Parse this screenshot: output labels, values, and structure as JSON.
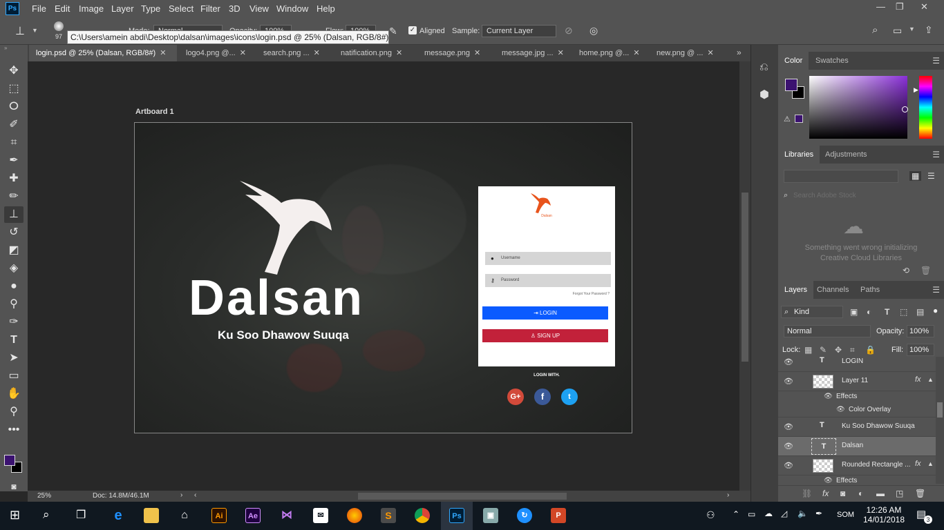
{
  "menubar": {
    "logo": "Ps",
    "items": [
      "File",
      "Edit",
      "Image",
      "Layer",
      "Type",
      "Select",
      "Filter",
      "3D",
      "View",
      "Window",
      "Help"
    ]
  },
  "options": {
    "brush_size": "97",
    "mode_label": "Mode:",
    "mode_value": "Normal",
    "opacity_label": "Opacity:",
    "opacity_value": "100%",
    "flow_label": "Flow:",
    "flow_value": "100%",
    "aligned_label": "Aligned",
    "sample_label": "Sample:",
    "sample_value": "Current Layer"
  },
  "tooltip": "C:\\Users\\amein abdi\\Desktop\\dalsan\\images\\icons\\login.psd @ 25% (Dalsan, RGB/8#)",
  "tabs": [
    {
      "label": "login.psd @ 25% (Dalsan, RGB/8#)"
    },
    {
      "label": "logo4.png @..."
    },
    {
      "label": "search.png ..."
    },
    {
      "label": "natification.png"
    },
    {
      "label": "message.png"
    },
    {
      "label": "message.jpg ..."
    },
    {
      "label": "home.png @..."
    },
    {
      "label": "new.png @ ..."
    }
  ],
  "artboard": {
    "label": "Artboard 1",
    "brand": "Dalsan",
    "tagline": "Ku Soo Dhawow Suuqa",
    "card": {
      "logo_text": "Dalsan",
      "username_placeholder": "Username",
      "password_placeholder": "Password",
      "forgot": "Forgot Your Password ?",
      "login_label": "LOGIN",
      "signup_label": "SIGN UP"
    },
    "login_with": "LOGIN WITH.",
    "social": {
      "google": "G+",
      "facebook": "f",
      "twitter": "t"
    },
    "colors": {
      "login": "#0b5bff",
      "signup": "#c2213a",
      "brand_orange": "#e8541c"
    }
  },
  "status": {
    "zoom": "25%",
    "doc": "Doc: 14.8M/46.1M"
  },
  "color_panel": {
    "tabs": [
      "Color",
      "Swatches"
    ],
    "foreground": "#3b1270",
    "background": "#000000"
  },
  "libraries_panel": {
    "tabs": [
      "Libraries",
      "Adjustments"
    ],
    "search_placeholder": "Search Adobe Stock",
    "error_line1": "Something went wrong initializing",
    "error_line2": "Creative Cloud Libraries"
  },
  "layers_panel": {
    "tabs": [
      "Layers",
      "Channels",
      "Paths"
    ],
    "filter": "Kind",
    "blend": "Normal",
    "opacity_label": "Opacity:",
    "opacity": "100%",
    "lock_label": "Lock:",
    "fill_label": "Fill:",
    "fill": "100%",
    "layers": [
      {
        "name": "LOGIN",
        "kind": "text"
      },
      {
        "name": "Layer 11",
        "kind": "pixel",
        "fx": "fx"
      },
      {
        "name": "Effects",
        "kind": "effects"
      },
      {
        "name": "Color Overlay",
        "kind": "effect"
      },
      {
        "name": "Ku Soo Dhawow Suuqa",
        "kind": "text"
      },
      {
        "name": "Dalsan",
        "kind": "text",
        "selected": true
      },
      {
        "name": "Rounded Rectangle ...",
        "kind": "shape",
        "fx": "fx"
      },
      {
        "name": "Effects",
        "kind": "effects"
      }
    ]
  },
  "taskbar": {
    "time": "12:26 AM",
    "date": "14/01/2018",
    "lang": "SOM",
    "notifications": "3",
    "apps": [
      "Ai",
      "Ae",
      "VS",
      "Mail",
      "Firefox",
      "Sublime",
      "Chrome",
      "Ps",
      "Monitor",
      "Sync",
      "PowerPoint"
    ]
  }
}
